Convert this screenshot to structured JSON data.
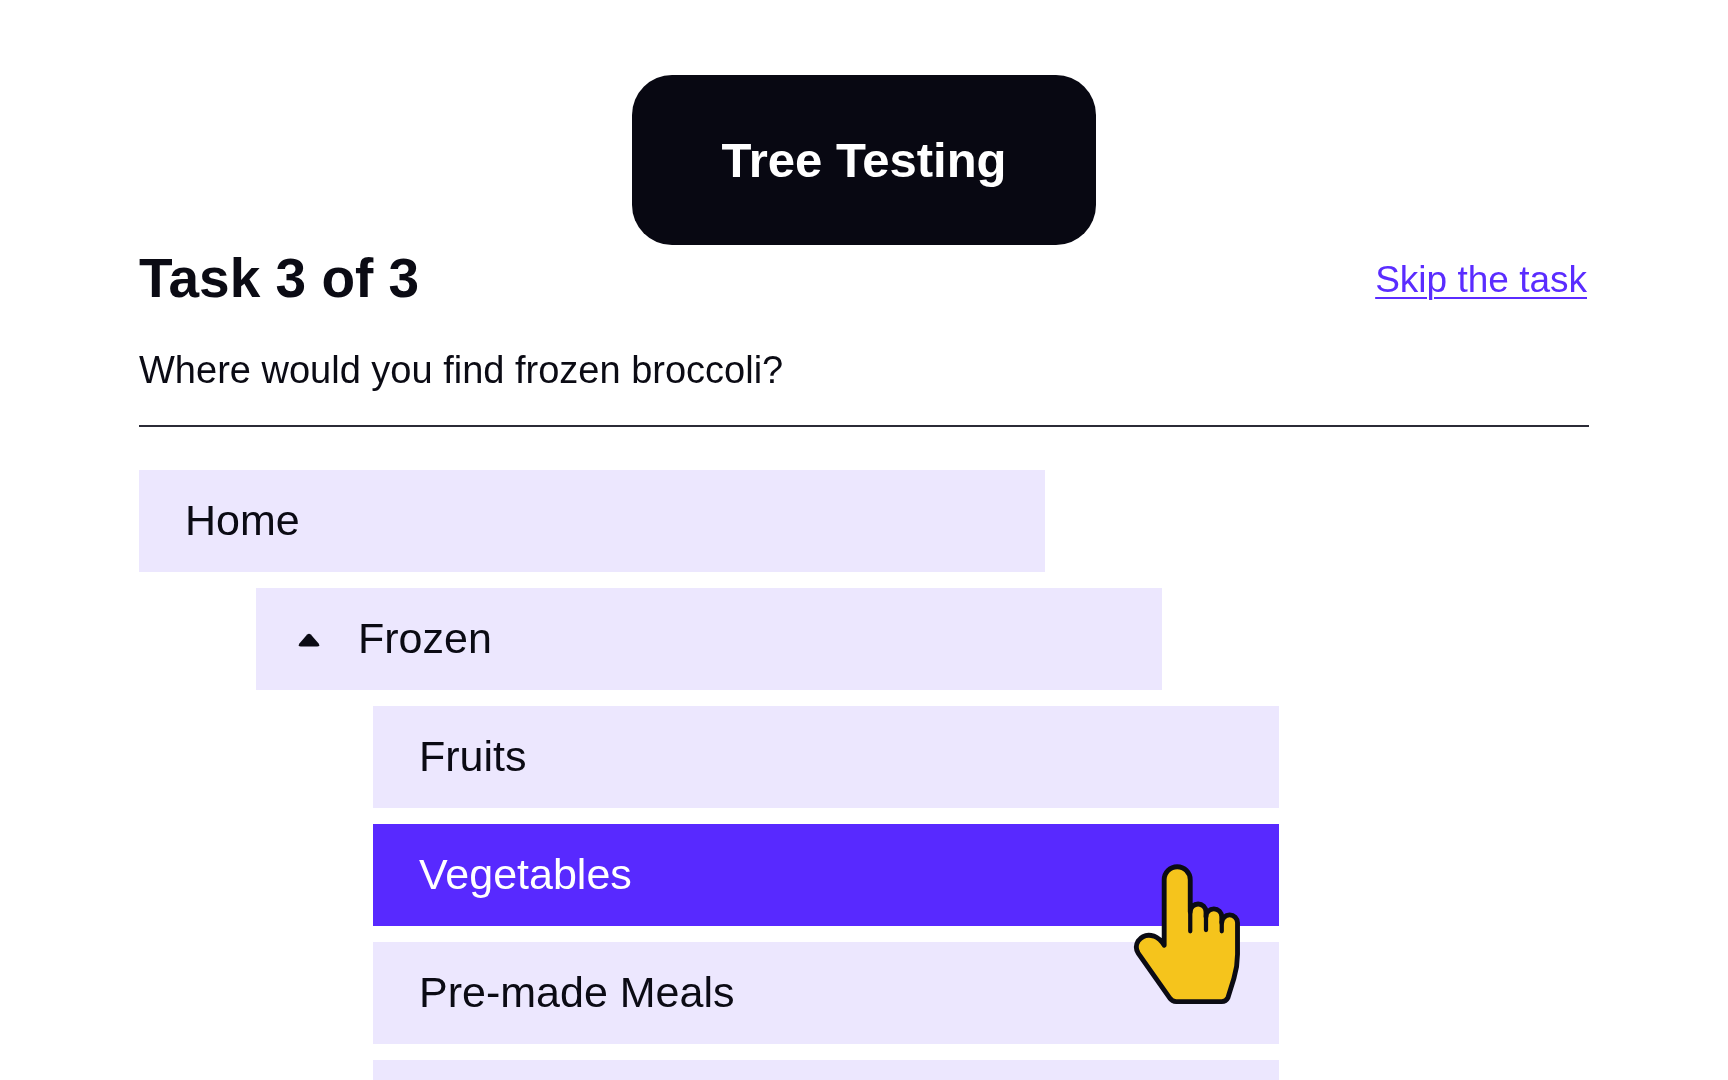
{
  "header": {
    "title": "Tree Testing"
  },
  "task": {
    "heading": "Task 3 of 3",
    "skip_link": "Skip the task",
    "question": "Where would you find frozen broccoli?"
  },
  "tree": [
    {
      "label": "Home",
      "selected": false,
      "children": [
        {
          "label": "Frozen",
          "expanded": true,
          "selected": false,
          "children": [
            {
              "label": "Fruits",
              "selected": false
            },
            {
              "label": "Vegetables",
              "selected": true
            },
            {
              "label": "Pre-made Meals",
              "selected": false
            },
            {
              "selected": false
            }
          ]
        }
      ]
    }
  ]
}
